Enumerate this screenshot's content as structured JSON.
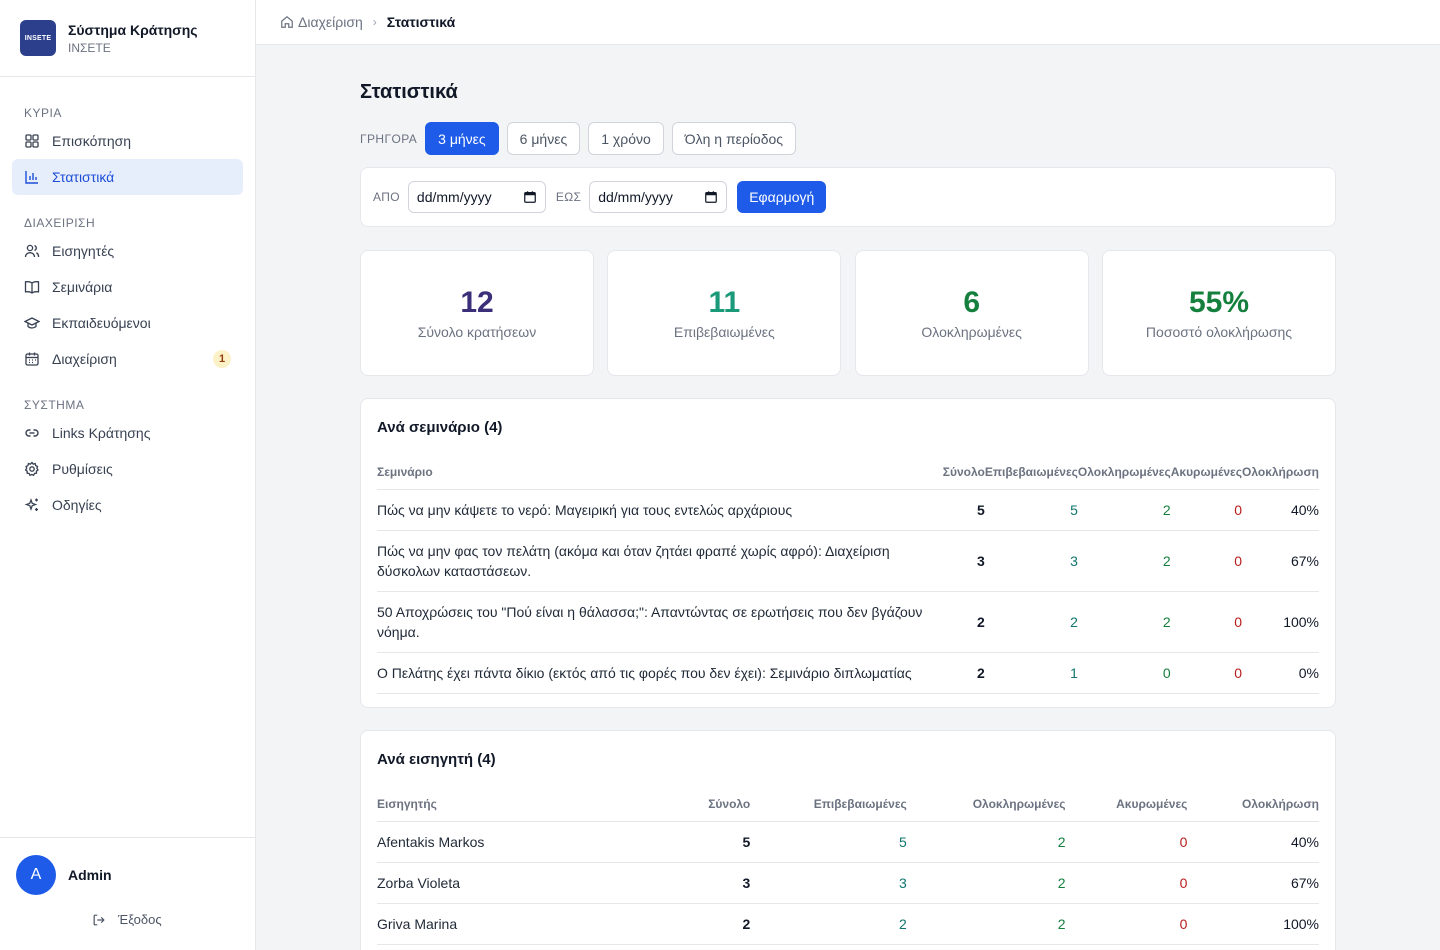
{
  "app": {
    "title": "Σύστημα Κράτησης",
    "subtitle": "INΣΕΤΕ",
    "logo_text": "INSETE"
  },
  "sidebar": {
    "sections": [
      {
        "label": "ΚΥΡΙΑ",
        "items": [
          {
            "label": "Επισκόπηση",
            "icon": "grid-icon"
          },
          {
            "label": "Στατιστικά",
            "icon": "bar-chart-icon",
            "active": true
          }
        ]
      },
      {
        "label": "ΔΙΑΧΕΙΡΙΣΗ",
        "items": [
          {
            "label": "Εισηγητές",
            "icon": "users-icon"
          },
          {
            "label": "Σεμινάρια",
            "icon": "book-icon"
          },
          {
            "label": "Εκπαιδευόμενοι",
            "icon": "graduation-cap-icon"
          },
          {
            "label": "Διαχείριση",
            "icon": "calendar-icon",
            "badge": "1"
          }
        ]
      },
      {
        "label": "ΣΥΣΤΗΜΑ",
        "items": [
          {
            "label": "Links Κράτησης",
            "icon": "link-icon"
          },
          {
            "label": "Ρυθμίσεις",
            "icon": "gear-icon"
          },
          {
            "label": "Οδηγίες",
            "icon": "sparkles-icon"
          }
        ]
      }
    ],
    "user": {
      "initial": "A",
      "name": "Admin",
      "logout_label": "Έξοδος"
    }
  },
  "breadcrumb": {
    "home": "Διαχείριση",
    "current": "Στατιστικά"
  },
  "page": {
    "title": "Στατιστικά"
  },
  "quick": {
    "label": "ΓΡΗΓΟΡΑ",
    "options": [
      "3 μήνες",
      "6 μήνες",
      "1 χρόνο",
      "Όλη η περίοδος"
    ],
    "active_index": 0
  },
  "filter": {
    "from_label": "ΑΠΟ",
    "to_label": "ΕΩΣ",
    "from_value": "dd/mm/yyyy",
    "to_value": "dd/mm/yyyy",
    "apply_label": "Εφαρμογή"
  },
  "stats": [
    {
      "value": "12",
      "label": "Σύνολο κρατήσεων",
      "color": "#3b2f7a"
    },
    {
      "value": "11",
      "label": "Επιβεβαιωμένες",
      "color": "#1b9a7a"
    },
    {
      "value": "6",
      "label": "Ολοκληρωμένες",
      "color": "#15803d"
    },
    {
      "value": "55%",
      "label": "Ποσοστό ολοκλήρωσης",
      "color": "#15803d"
    }
  ],
  "by_seminar": {
    "title": "Ανά σεμινάριο (4)",
    "columns": [
      "Σεμινάριο",
      "Σύνολο",
      "Επιβεβαιωμένες",
      "Ολοκληρωμένες",
      "Ακυρωμένες",
      "Ολοκλήρωση"
    ],
    "rows": [
      {
        "name": "Πώς να μην κάψετε το νερό: Μαγειρική για τους εντελώς αρχάριους",
        "total": "5",
        "confirmed": "5",
        "completed": "2",
        "cancelled": "0",
        "rate": "40%"
      },
      {
        "name": "Πώς να μην φας τον πελάτη (ακόμα και όταν ζητάει φραπέ χωρίς αφρό): Διαχείριση δύσκολων καταστάσεων.",
        "total": "3",
        "confirmed": "3",
        "completed": "2",
        "cancelled": "0",
        "rate": "67%"
      },
      {
        "name": "50 Αποχρώσεις του \"Πού είναι η θάλασσα;\": Απαντώντας σε ερωτήσεις που δεν βγάζουν νόημα.",
        "total": "2",
        "confirmed": "2",
        "completed": "2",
        "cancelled": "0",
        "rate": "100%"
      },
      {
        "name": "Ο Πελάτης έχει πάντα δίκιο (εκτός από τις φορές που δεν έχει): Σεμινάριο διπλωματίας",
        "total": "2",
        "confirmed": "1",
        "completed": "0",
        "cancelled": "0",
        "rate": "0%"
      }
    ]
  },
  "by_instructor": {
    "title": "Ανά εισηγητή (4)",
    "columns": [
      "Εισηγητής",
      "Σύνολο",
      "Επιβεβαιωμένες",
      "Ολοκληρωμένες",
      "Ακυρωμένες",
      "Ολοκλήρωση"
    ],
    "rows": [
      {
        "name": "Afentakis Markos",
        "total": "5",
        "confirmed": "5",
        "completed": "2",
        "cancelled": "0",
        "rate": "40%"
      },
      {
        "name": "Zorba Violeta",
        "total": "3",
        "confirmed": "3",
        "completed": "2",
        "cancelled": "0",
        "rate": "67%"
      },
      {
        "name": "Griva Marina",
        "total": "2",
        "confirmed": "2",
        "completed": "2",
        "cancelled": "0",
        "rate": "100%"
      }
    ]
  }
}
